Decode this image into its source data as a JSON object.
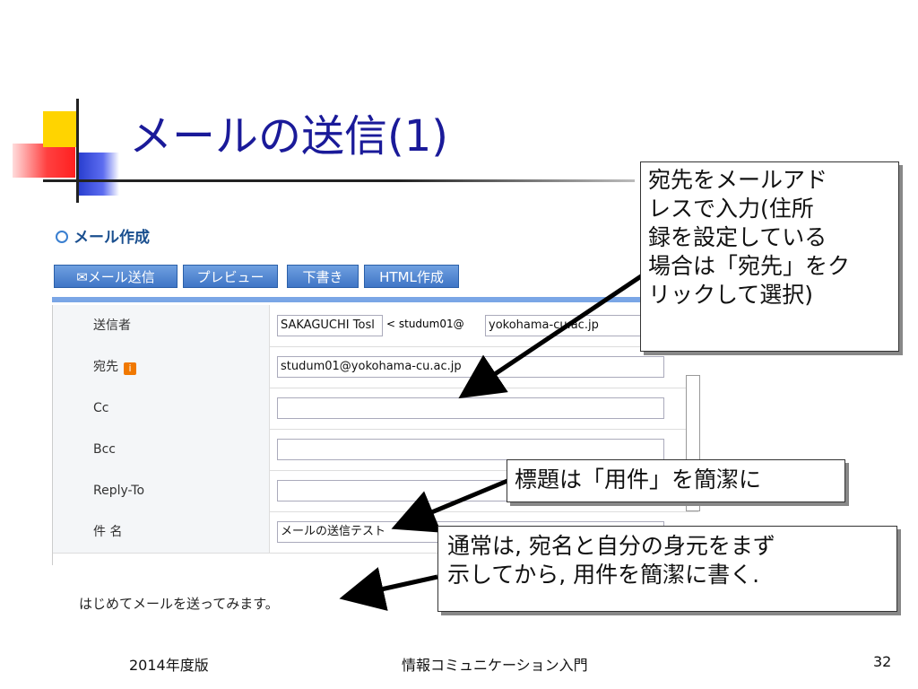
{
  "slide": {
    "title": "メールの送信(1)",
    "footer_left": "2014年度版",
    "footer_center": "情報コミュニケーション入門",
    "page_number": "32"
  },
  "webmail": {
    "heading": "メール作成",
    "toolbar": [
      {
        "label": "✉メール送信"
      },
      {
        "label": "プレビュー"
      },
      {
        "label": "下書き"
      },
      {
        "label": "HTML作成"
      }
    ],
    "fields": [
      {
        "label": "送信者",
        "value": "SAKAGUCHI Tosl",
        "extra": "< studum01@",
        "domain": "yokohama-cu.ac.jp"
      },
      {
        "label": "宛先",
        "value": "studum01@yokohama-cu.ac.jp"
      },
      {
        "label": "Cc",
        "value": ""
      },
      {
        "label": "Bcc",
        "value": ""
      },
      {
        "label": "Reply-To",
        "value": ""
      },
      {
        "label": "件 名",
        "value": "メールの送信テスト"
      }
    ],
    "info_badge": "i",
    "body": "はじめてメールを送ってみます。"
  },
  "callouts": {
    "address": "宛先をメールアド\nレスで入力(住所\n録を設定している\n場合は「宛先」をク\nリックして選択)",
    "subject": "標題は「用件」を簡潔に",
    "body": "通常は, 宛名と自分の身元をまず\n示してから, 用件を簡潔に書く."
  }
}
